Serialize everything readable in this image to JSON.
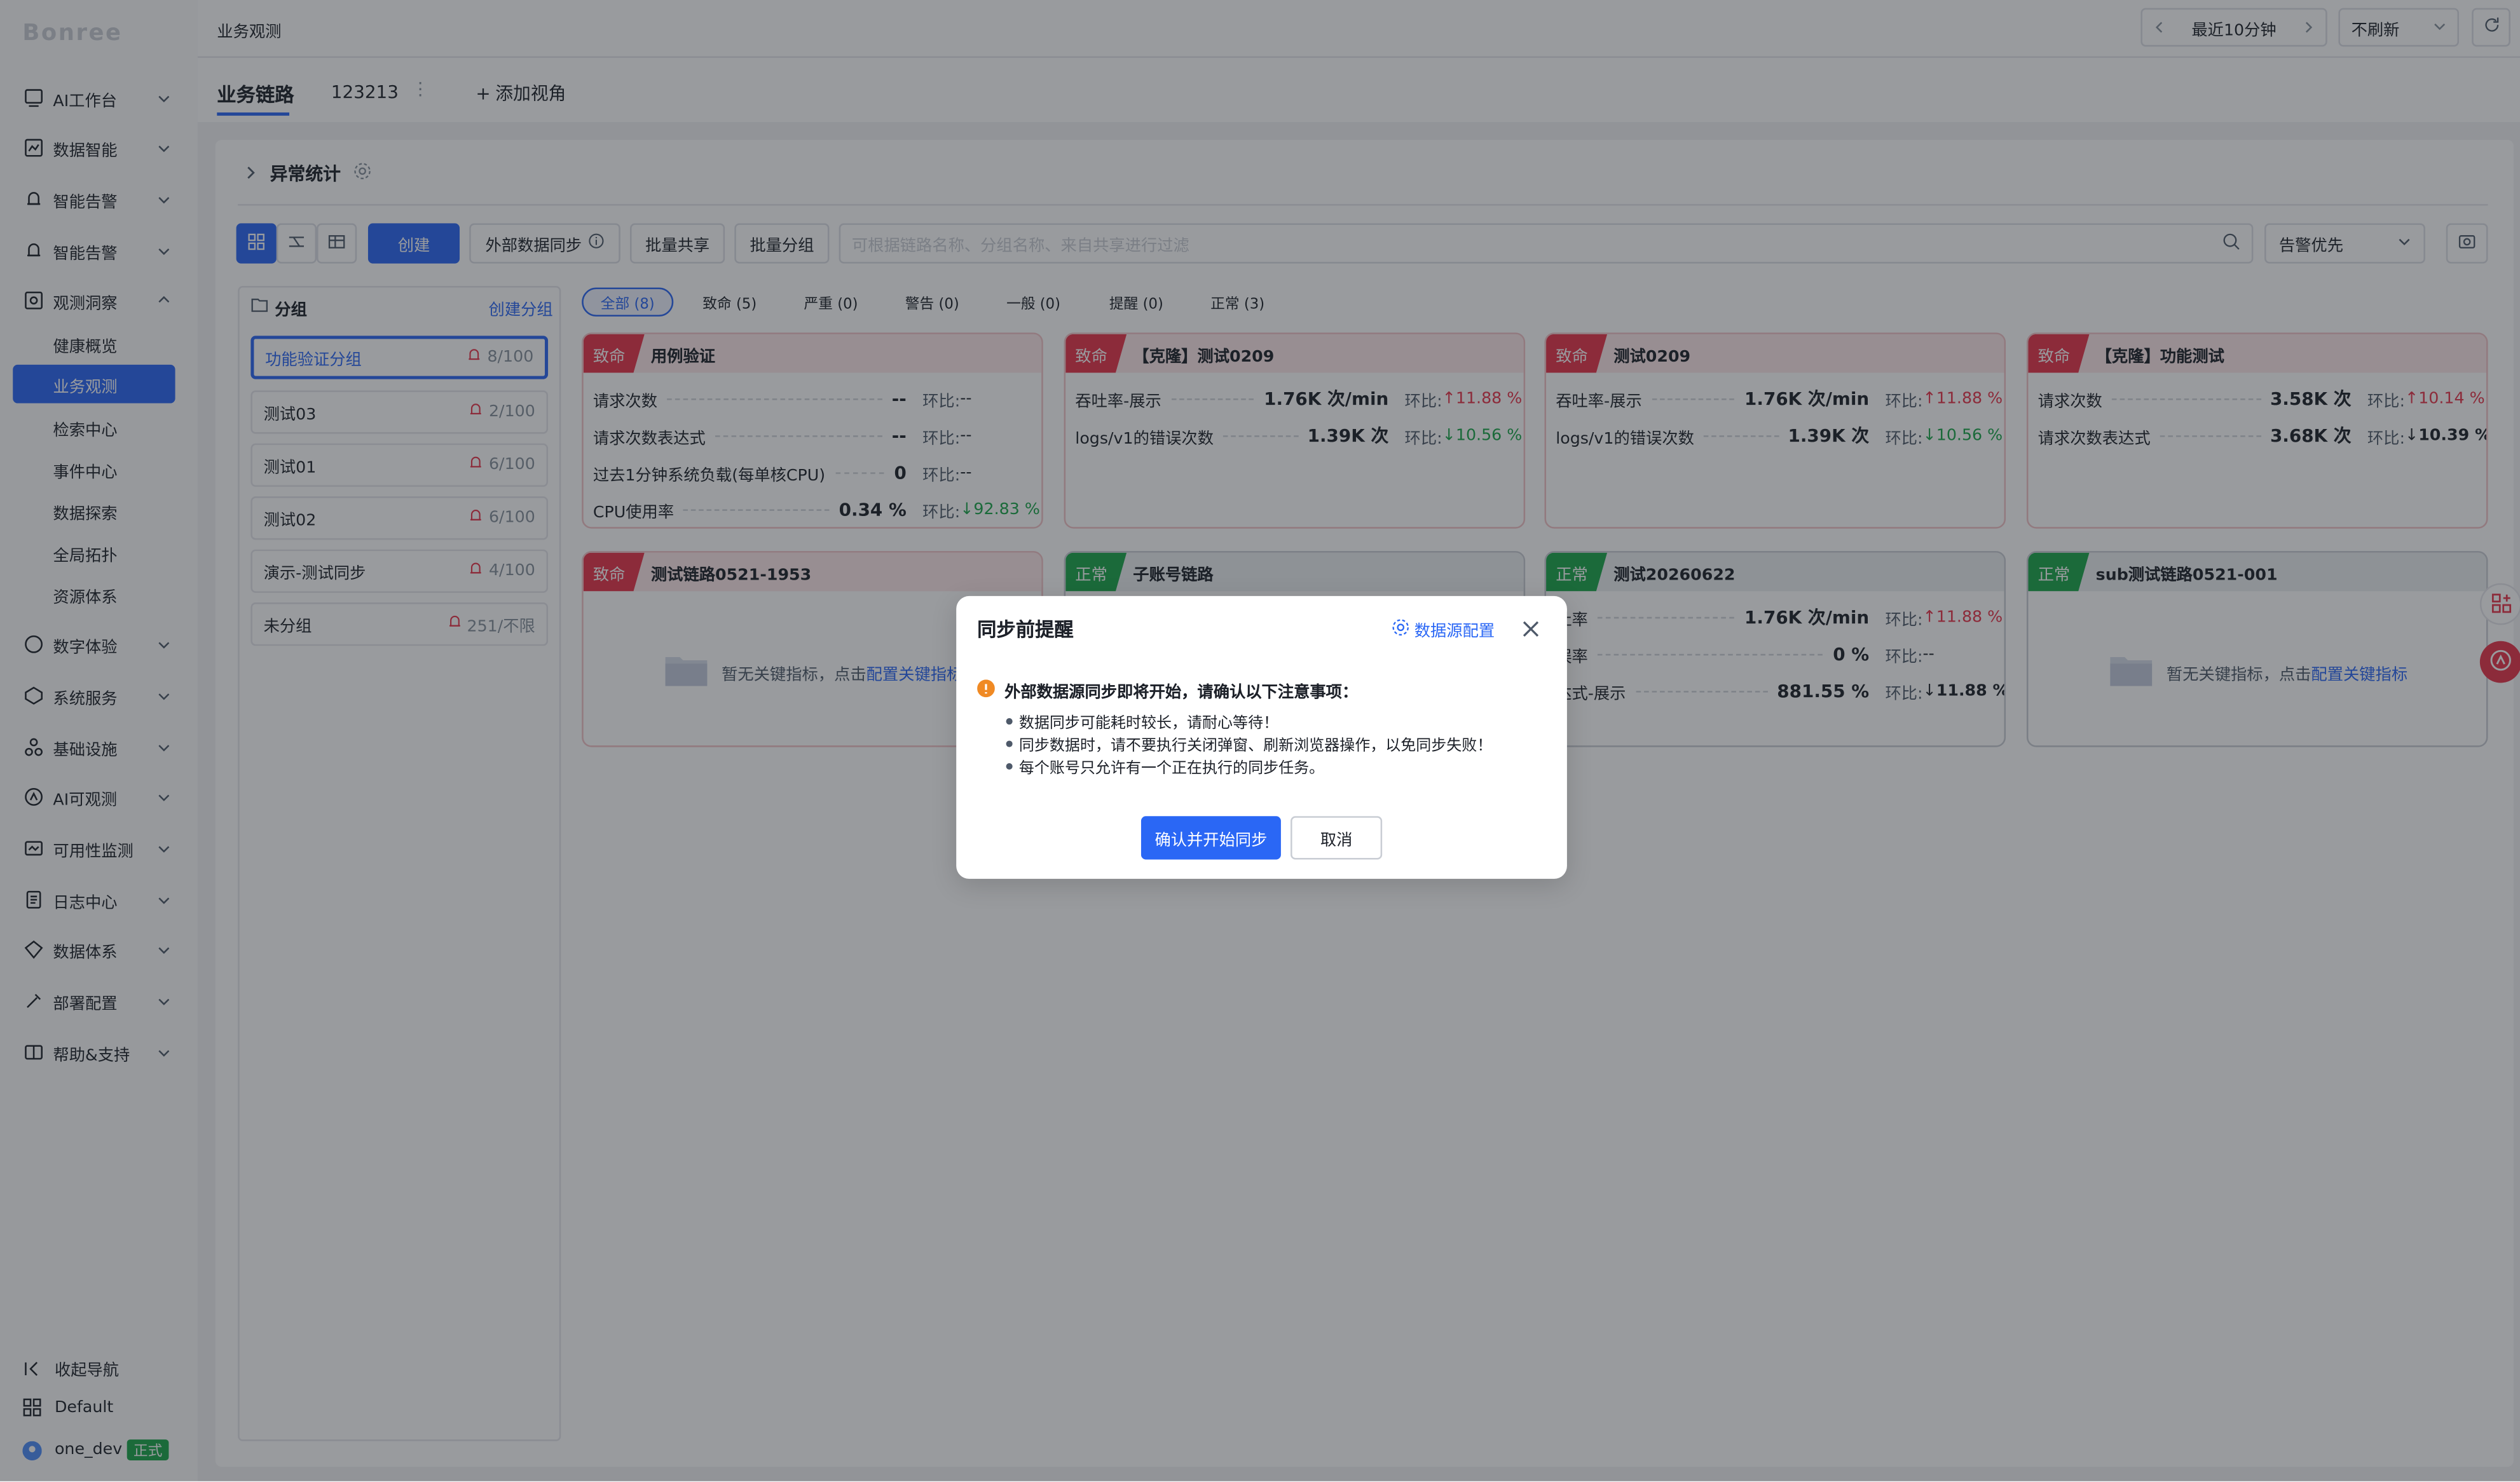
{
  "sidebar": {
    "logo": "Bonree",
    "items": [
      {
        "label": "AI工作台",
        "icon": "ai-workbench-icon"
      },
      {
        "label": "数据智能",
        "icon": "data-intelligence-icon"
      },
      {
        "label": "智能告警",
        "icon": "alert-icon"
      },
      {
        "label": "智能告警",
        "icon": "alert-icon"
      },
      {
        "label": "观测洞察",
        "icon": "observe-icon"
      },
      {
        "label": "数字体验",
        "icon": "digital-experience-icon"
      },
      {
        "label": "系统服务",
        "icon": "system-service-icon"
      },
      {
        "label": "基础设施",
        "icon": "infrastructure-icon"
      },
      {
        "label": "AI可观测",
        "icon": "ai-observe-icon"
      },
      {
        "label": "可用性监测",
        "icon": "availability-icon"
      },
      {
        "label": "日志中心",
        "icon": "log-icon"
      },
      {
        "label": "数据体系",
        "icon": "data-system-icon"
      },
      {
        "label": "部署配置",
        "icon": "deploy-config-icon"
      },
      {
        "label": "帮助&支持",
        "icon": "help-icon"
      }
    ],
    "subitems": [
      "健康概览",
      "业务观测",
      "检索中心",
      "事件中心",
      "数据探索",
      "全局拓扑",
      "资源体系"
    ],
    "collapse": "收起导航",
    "workspace": "Default",
    "user": "one_dev",
    "user_tag": "正式"
  },
  "topbar": {
    "breadcrumb": "业务观测",
    "time_range": "最近10分钟",
    "refresh": "不刷新"
  },
  "tabs": {
    "items": [
      "业务链路",
      "123213"
    ],
    "add": "添加视角"
  },
  "section": {
    "title": "异常统计"
  },
  "toolbar": {
    "create": "创建",
    "sync": "外部数据同步",
    "share": "批量共享",
    "group": "批量分组",
    "search_placeholder": "可根据链路名称、分组名称、来自共享进行过滤",
    "sort": "告警优先"
  },
  "groups": {
    "title": "分组",
    "create": "创建分组",
    "items": [
      {
        "name": "功能验证分组",
        "count": "8/100"
      },
      {
        "name": "测试03",
        "count": "2/100"
      },
      {
        "name": "测试01",
        "count": "6/100"
      },
      {
        "name": "测试02",
        "count": "6/100"
      },
      {
        "name": "演示-测试同步",
        "count": "4/100"
      },
      {
        "name": "未分组",
        "count": "251/不限"
      }
    ]
  },
  "filters": [
    "全部 (8)",
    "致命 (5)",
    "严重 (0)",
    "警告 (0)",
    "一般 (0)",
    "提醒 (0)",
    "正常 (3)"
  ],
  "cards": [
    {
      "status": "致命",
      "name": "用例验证",
      "metrics": [
        {
          "name": "请求次数",
          "value": "--",
          "ratio_label": "环比:",
          "ratio": "--"
        },
        {
          "name": "请求次数表达式",
          "value": "--",
          "ratio_label": "环比:",
          "ratio": "--"
        },
        {
          "name": "过去1分钟系统负载(每单核CPU)",
          "value": "0",
          "ratio_label": "环比:",
          "ratio": "--"
        },
        {
          "name": "CPU使用率",
          "value": "0.34 %",
          "ratio_label": "环比:",
          "ratio": "92.83 %"
        }
      ]
    },
    {
      "status": "致命",
      "name": "【克隆】测试0209",
      "metrics": [
        {
          "name": "吞吐率-展示",
          "value": "1.76K 次/min",
          "ratio_label": "环比:",
          "ratio": "11.88 %"
        },
        {
          "name": "logs/v1的错误次数",
          "value": "1.39K 次",
          "ratio_label": "环比:",
          "ratio": "10.56 %"
        }
      ]
    },
    {
      "status": "致命",
      "name": "测试0209",
      "metrics": [
        {
          "name": "吞吐率-展示",
          "value": "1.76K 次/min",
          "ratio_label": "环比:",
          "ratio": "11.88 %"
        },
        {
          "name": "logs/v1的错误次数",
          "value": "1.39K 次",
          "ratio_label": "环比:",
          "ratio": "10.56 %"
        }
      ]
    },
    {
      "status": "致命",
      "name": "【克隆】功能测试",
      "metrics": [
        {
          "name": "请求次数",
          "value": "3.58K 次",
          "ratio_label": "环比:",
          "ratio": "10.14 %"
        },
        {
          "name": "请求次数表达式",
          "value": "3.68K 次",
          "ratio_label": "环比:",
          "ratio": "10.39 %"
        }
      ]
    },
    {
      "status": "致命",
      "name": "测试链路0521-1953",
      "empty": "暂无关键指标，点击",
      "empty_link": "配置关键指标"
    },
    {
      "status": "正常",
      "name": "子账号链路"
    },
    {
      "status": "正常",
      "name": "测试20260622",
      "metrics": [
        {
          "name": "吐率",
          "value": "1.76K 次/min",
          "ratio_label": "环比:",
          "ratio": "11.88 %"
        },
        {
          "name": "误率",
          "value": "0 %",
          "ratio_label": "环比:",
          "ratio": "--"
        },
        {
          "name": "达式-展示",
          "value": "881.55 %",
          "ratio_label": "环比:",
          "ratio": "11.88 %"
        }
      ]
    },
    {
      "status": "正常",
      "name": "sub测试链路0521-001",
      "empty": "暂无关键指标，点击",
      "empty_link": "配置关键指标"
    }
  ],
  "modal": {
    "title": "同步前提醒",
    "source_config": "数据源配置",
    "warning": "外部数据源同步即将开始，请确认以下注意事项：",
    "bullets": [
      "数据同步可能耗时较长，请耐心等待！",
      "同步数据时，请不要执行关闭弹窗、刷新浏览器操作，以免同步失败！",
      "每个账号只允许有一个正在执行的同步任务。"
    ],
    "confirm": "确认并开始同步",
    "cancel": "取消"
  },
  "colors": {
    "accent": "#2a67f5",
    "fatal": "#e8334a",
    "normal": "#1aa64a",
    "warning": "#f08a24"
  }
}
